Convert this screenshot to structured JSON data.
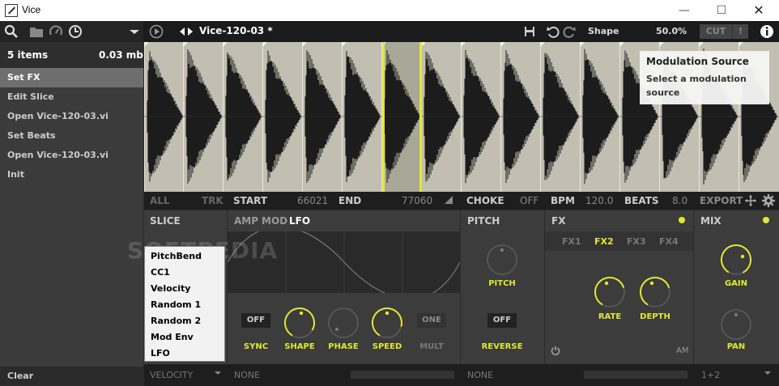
{
  "window": {
    "title": "Vice",
    "minimize_icon": "minimize-icon",
    "maximize_icon": "maximize-icon",
    "close_icon": "close-icon"
  },
  "toolbar": {
    "filename": "Vice-120-03 *",
    "shape_label": "Shape",
    "shape_value": "50.0%",
    "cut_label": "CUT",
    "excl_label": "!"
  },
  "sidebar": {
    "count": "5 items",
    "size": "0.03 mb",
    "items": [
      {
        "label": "Set FX",
        "selected": true
      },
      {
        "label": "Edit Slice",
        "selected": false
      },
      {
        "label": "Open Vice-120-03.vi",
        "selected": false
      },
      {
        "label": "Set Beats",
        "selected": false
      },
      {
        "label": "Open Vice-120-03.vi",
        "selected": false
      },
      {
        "label": "Init",
        "selected": false
      }
    ],
    "clear": "Clear"
  },
  "tooltip": {
    "title": "Modulation Source",
    "line1": "Select a modulation",
    "line2": "source"
  },
  "params": {
    "all": "ALL",
    "trk": "TRK",
    "start_label": "START",
    "start_value": "66021",
    "end_label": "END",
    "end_value": "77060",
    "choke_label": "CHOKE",
    "choke_value": "OFF",
    "bpm_label": "BPM",
    "bpm_value": "120.0",
    "beats_label": "BEATS",
    "beats_value": "8.0",
    "export_label": "EXPORT"
  },
  "panels": {
    "slice": {
      "title": "SLICE"
    },
    "amp": "AMP",
    "mod": "MOD",
    "lfo": "LFO",
    "lfo_controls": {
      "sync_btn": "OFF",
      "one_btn": "ONE",
      "sync": "SYNC",
      "shape": "SHAPE",
      "phase": "PHASE",
      "speed": "SPEED",
      "mult": "MULT"
    },
    "pitch": {
      "title": "PITCH",
      "knob": "PITCH",
      "reverse_btn": "OFF",
      "reverse": "REVERSE"
    },
    "fx": {
      "title": "FX",
      "tabs": [
        "FX1",
        "FX2",
        "FX3",
        "FX4"
      ],
      "active_tab": "FX2",
      "rate": "RATE",
      "depth": "DEPTH",
      "am": "AM"
    },
    "mix": {
      "title": "MIX",
      "gain": "GAIN",
      "pan": "PAN"
    }
  },
  "bottom": {
    "velocity": "VELOCITY",
    "none1": "NONE",
    "none2": "NONE",
    "output": "1+2"
  },
  "popup": {
    "items": [
      "PitchBend",
      "CC1",
      "Velocity",
      "Random 1",
      "Random 2",
      "Mod Env",
      "LFO"
    ]
  },
  "watermark": "SOFTPEDIA",
  "colors": {
    "accent": "#e1e832",
    "wave_bg": "#c2bfb2",
    "panel_bg": "#3c3c3c"
  }
}
